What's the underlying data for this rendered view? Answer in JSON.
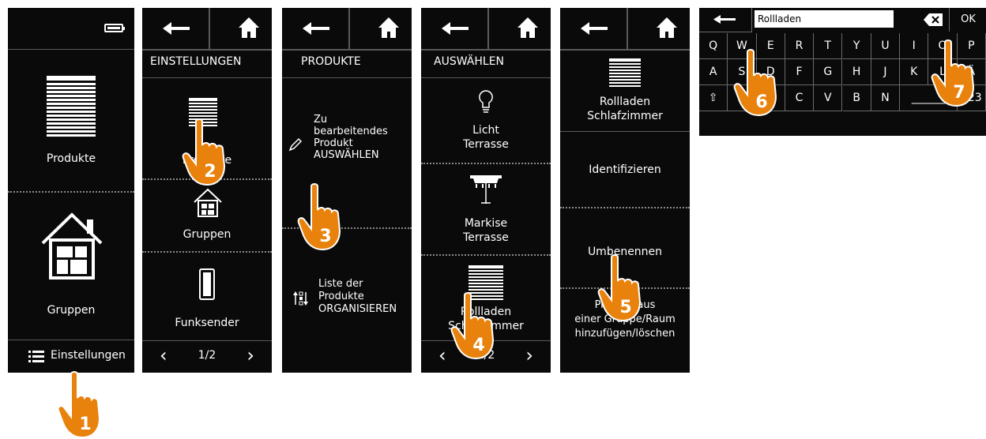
{
  "colors": {
    "background": "#0a0a0a",
    "accent": "#e8820c",
    "text": "#ffffff",
    "divider": "#5a5a5a"
  },
  "screen1": {
    "item1": "Produkte",
    "item2": "Gruppen",
    "settings": "Einstellungen",
    "battery_icon": "battery-icon"
  },
  "screen2": {
    "title": "EINSTELLUNGEN",
    "items": [
      "Produkte",
      "Gruppen",
      "Funksender"
    ],
    "page": "1/2"
  },
  "screen3": {
    "title": "PRODUKTE",
    "edit_lines": [
      "Zu",
      "bearbeitendes",
      "Produkt",
      "AUSWÄHLEN"
    ],
    "organize_lines": [
      "Liste der",
      "Produkte",
      "ORGANISIEREN"
    ]
  },
  "screen4": {
    "title": "AUSWÄHLEN",
    "items": [
      {
        "l1": "Licht",
        "l2": "Terrasse"
      },
      {
        "l1": "Markise",
        "l2": "Terrasse"
      },
      {
        "l1": "Rollladen",
        "l2": "Schlafzimmer"
      }
    ],
    "page": "1/2"
  },
  "screen5": {
    "product_l1": "Rollladen",
    "product_l2": "Schlafzimmer",
    "actions": [
      "Identifizieren",
      "Umbenennen"
    ],
    "group_lines": [
      "Produkt aus",
      "einer Gruppe/Raum",
      "hinzufügen/löschen"
    ]
  },
  "keyboard": {
    "input_value": "Rollladen",
    "ok": "OK",
    "row1": [
      "Q",
      "W",
      "E",
      "R",
      "T",
      "Y",
      "U",
      "I",
      "O",
      "P"
    ],
    "row2": [
      "A",
      "S",
      "D",
      "F",
      "G",
      "H",
      "J",
      "K",
      "L",
      "Ä"
    ],
    "row3": [
      "Z",
      "X",
      "C",
      "V",
      "B",
      "N"
    ],
    "space": "______",
    "numbers": "123"
  },
  "steps": [
    "1",
    "2",
    "3",
    "4",
    "5",
    "6",
    "7"
  ]
}
